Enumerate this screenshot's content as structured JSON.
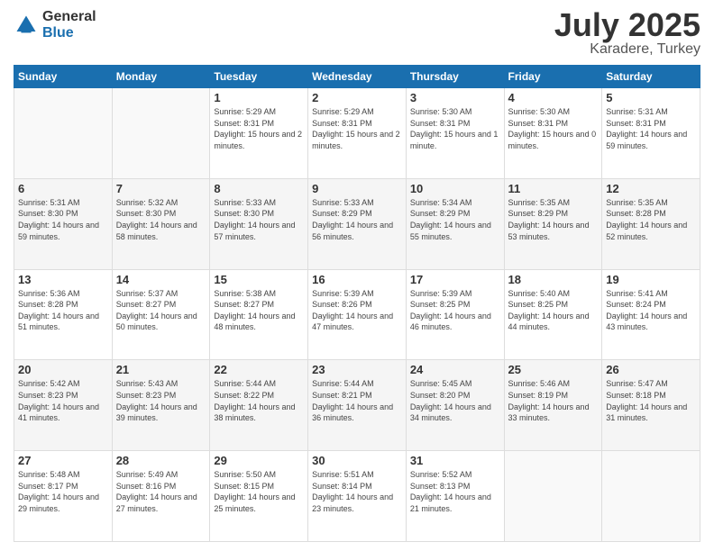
{
  "logo": {
    "general": "General",
    "blue": "Blue"
  },
  "header": {
    "month": "July 2025",
    "location": "Karadere, Turkey"
  },
  "days": [
    "Sunday",
    "Monday",
    "Tuesday",
    "Wednesday",
    "Thursday",
    "Friday",
    "Saturday"
  ],
  "weeks": [
    [
      {
        "day": "",
        "sunrise": "",
        "sunset": "",
        "daylight": ""
      },
      {
        "day": "",
        "sunrise": "",
        "sunset": "",
        "daylight": ""
      },
      {
        "day": "1",
        "sunrise": "Sunrise: 5:29 AM",
        "sunset": "Sunset: 8:31 PM",
        "daylight": "Daylight: 15 hours and 2 minutes."
      },
      {
        "day": "2",
        "sunrise": "Sunrise: 5:29 AM",
        "sunset": "Sunset: 8:31 PM",
        "daylight": "Daylight: 15 hours and 2 minutes."
      },
      {
        "day": "3",
        "sunrise": "Sunrise: 5:30 AM",
        "sunset": "Sunset: 8:31 PM",
        "daylight": "Daylight: 15 hours and 1 minute."
      },
      {
        "day": "4",
        "sunrise": "Sunrise: 5:30 AM",
        "sunset": "Sunset: 8:31 PM",
        "daylight": "Daylight: 15 hours and 0 minutes."
      },
      {
        "day": "5",
        "sunrise": "Sunrise: 5:31 AM",
        "sunset": "Sunset: 8:31 PM",
        "daylight": "Daylight: 14 hours and 59 minutes."
      }
    ],
    [
      {
        "day": "6",
        "sunrise": "Sunrise: 5:31 AM",
        "sunset": "Sunset: 8:30 PM",
        "daylight": "Daylight: 14 hours and 59 minutes."
      },
      {
        "day": "7",
        "sunrise": "Sunrise: 5:32 AM",
        "sunset": "Sunset: 8:30 PM",
        "daylight": "Daylight: 14 hours and 58 minutes."
      },
      {
        "day": "8",
        "sunrise": "Sunrise: 5:33 AM",
        "sunset": "Sunset: 8:30 PM",
        "daylight": "Daylight: 14 hours and 57 minutes."
      },
      {
        "day": "9",
        "sunrise": "Sunrise: 5:33 AM",
        "sunset": "Sunset: 8:29 PM",
        "daylight": "Daylight: 14 hours and 56 minutes."
      },
      {
        "day": "10",
        "sunrise": "Sunrise: 5:34 AM",
        "sunset": "Sunset: 8:29 PM",
        "daylight": "Daylight: 14 hours and 55 minutes."
      },
      {
        "day": "11",
        "sunrise": "Sunrise: 5:35 AM",
        "sunset": "Sunset: 8:29 PM",
        "daylight": "Daylight: 14 hours and 53 minutes."
      },
      {
        "day": "12",
        "sunrise": "Sunrise: 5:35 AM",
        "sunset": "Sunset: 8:28 PM",
        "daylight": "Daylight: 14 hours and 52 minutes."
      }
    ],
    [
      {
        "day": "13",
        "sunrise": "Sunrise: 5:36 AM",
        "sunset": "Sunset: 8:28 PM",
        "daylight": "Daylight: 14 hours and 51 minutes."
      },
      {
        "day": "14",
        "sunrise": "Sunrise: 5:37 AM",
        "sunset": "Sunset: 8:27 PM",
        "daylight": "Daylight: 14 hours and 50 minutes."
      },
      {
        "day": "15",
        "sunrise": "Sunrise: 5:38 AM",
        "sunset": "Sunset: 8:27 PM",
        "daylight": "Daylight: 14 hours and 48 minutes."
      },
      {
        "day": "16",
        "sunrise": "Sunrise: 5:39 AM",
        "sunset": "Sunset: 8:26 PM",
        "daylight": "Daylight: 14 hours and 47 minutes."
      },
      {
        "day": "17",
        "sunrise": "Sunrise: 5:39 AM",
        "sunset": "Sunset: 8:25 PM",
        "daylight": "Daylight: 14 hours and 46 minutes."
      },
      {
        "day": "18",
        "sunrise": "Sunrise: 5:40 AM",
        "sunset": "Sunset: 8:25 PM",
        "daylight": "Daylight: 14 hours and 44 minutes."
      },
      {
        "day": "19",
        "sunrise": "Sunrise: 5:41 AM",
        "sunset": "Sunset: 8:24 PM",
        "daylight": "Daylight: 14 hours and 43 minutes."
      }
    ],
    [
      {
        "day": "20",
        "sunrise": "Sunrise: 5:42 AM",
        "sunset": "Sunset: 8:23 PM",
        "daylight": "Daylight: 14 hours and 41 minutes."
      },
      {
        "day": "21",
        "sunrise": "Sunrise: 5:43 AM",
        "sunset": "Sunset: 8:23 PM",
        "daylight": "Daylight: 14 hours and 39 minutes."
      },
      {
        "day": "22",
        "sunrise": "Sunrise: 5:44 AM",
        "sunset": "Sunset: 8:22 PM",
        "daylight": "Daylight: 14 hours and 38 minutes."
      },
      {
        "day": "23",
        "sunrise": "Sunrise: 5:44 AM",
        "sunset": "Sunset: 8:21 PM",
        "daylight": "Daylight: 14 hours and 36 minutes."
      },
      {
        "day": "24",
        "sunrise": "Sunrise: 5:45 AM",
        "sunset": "Sunset: 8:20 PM",
        "daylight": "Daylight: 14 hours and 34 minutes."
      },
      {
        "day": "25",
        "sunrise": "Sunrise: 5:46 AM",
        "sunset": "Sunset: 8:19 PM",
        "daylight": "Daylight: 14 hours and 33 minutes."
      },
      {
        "day": "26",
        "sunrise": "Sunrise: 5:47 AM",
        "sunset": "Sunset: 8:18 PM",
        "daylight": "Daylight: 14 hours and 31 minutes."
      }
    ],
    [
      {
        "day": "27",
        "sunrise": "Sunrise: 5:48 AM",
        "sunset": "Sunset: 8:17 PM",
        "daylight": "Daylight: 14 hours and 29 minutes."
      },
      {
        "day": "28",
        "sunrise": "Sunrise: 5:49 AM",
        "sunset": "Sunset: 8:16 PM",
        "daylight": "Daylight: 14 hours and 27 minutes."
      },
      {
        "day": "29",
        "sunrise": "Sunrise: 5:50 AM",
        "sunset": "Sunset: 8:15 PM",
        "daylight": "Daylight: 14 hours and 25 minutes."
      },
      {
        "day": "30",
        "sunrise": "Sunrise: 5:51 AM",
        "sunset": "Sunset: 8:14 PM",
        "daylight": "Daylight: 14 hours and 23 minutes."
      },
      {
        "day": "31",
        "sunrise": "Sunrise: 5:52 AM",
        "sunset": "Sunset: 8:13 PM",
        "daylight": "Daylight: 14 hours and 21 minutes."
      },
      {
        "day": "",
        "sunrise": "",
        "sunset": "",
        "daylight": ""
      },
      {
        "day": "",
        "sunrise": "",
        "sunset": "",
        "daylight": ""
      }
    ]
  ]
}
